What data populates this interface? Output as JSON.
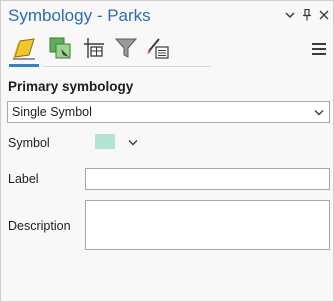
{
  "pane": {
    "title": "Symbology - Parks"
  },
  "toolbar": {
    "tools": [
      {
        "icon": "primary-symbology-icon"
      },
      {
        "icon": "vary-symbology-icon"
      },
      {
        "icon": "symbol-layers-icon"
      },
      {
        "icon": "filter-icon"
      },
      {
        "icon": "symbol-properties-icon"
      }
    ],
    "active_index": 0
  },
  "primary": {
    "section_title": "Primary symbology",
    "selected_type": "Single Symbol",
    "symbol_label": "Symbol",
    "symbol_color": "#b3e3d2",
    "label_label": "Label",
    "label_value": "",
    "description_label": "Description",
    "description_value": ""
  },
  "colors": {
    "accent": "#2b84d2",
    "title": "#2b6cb3"
  }
}
